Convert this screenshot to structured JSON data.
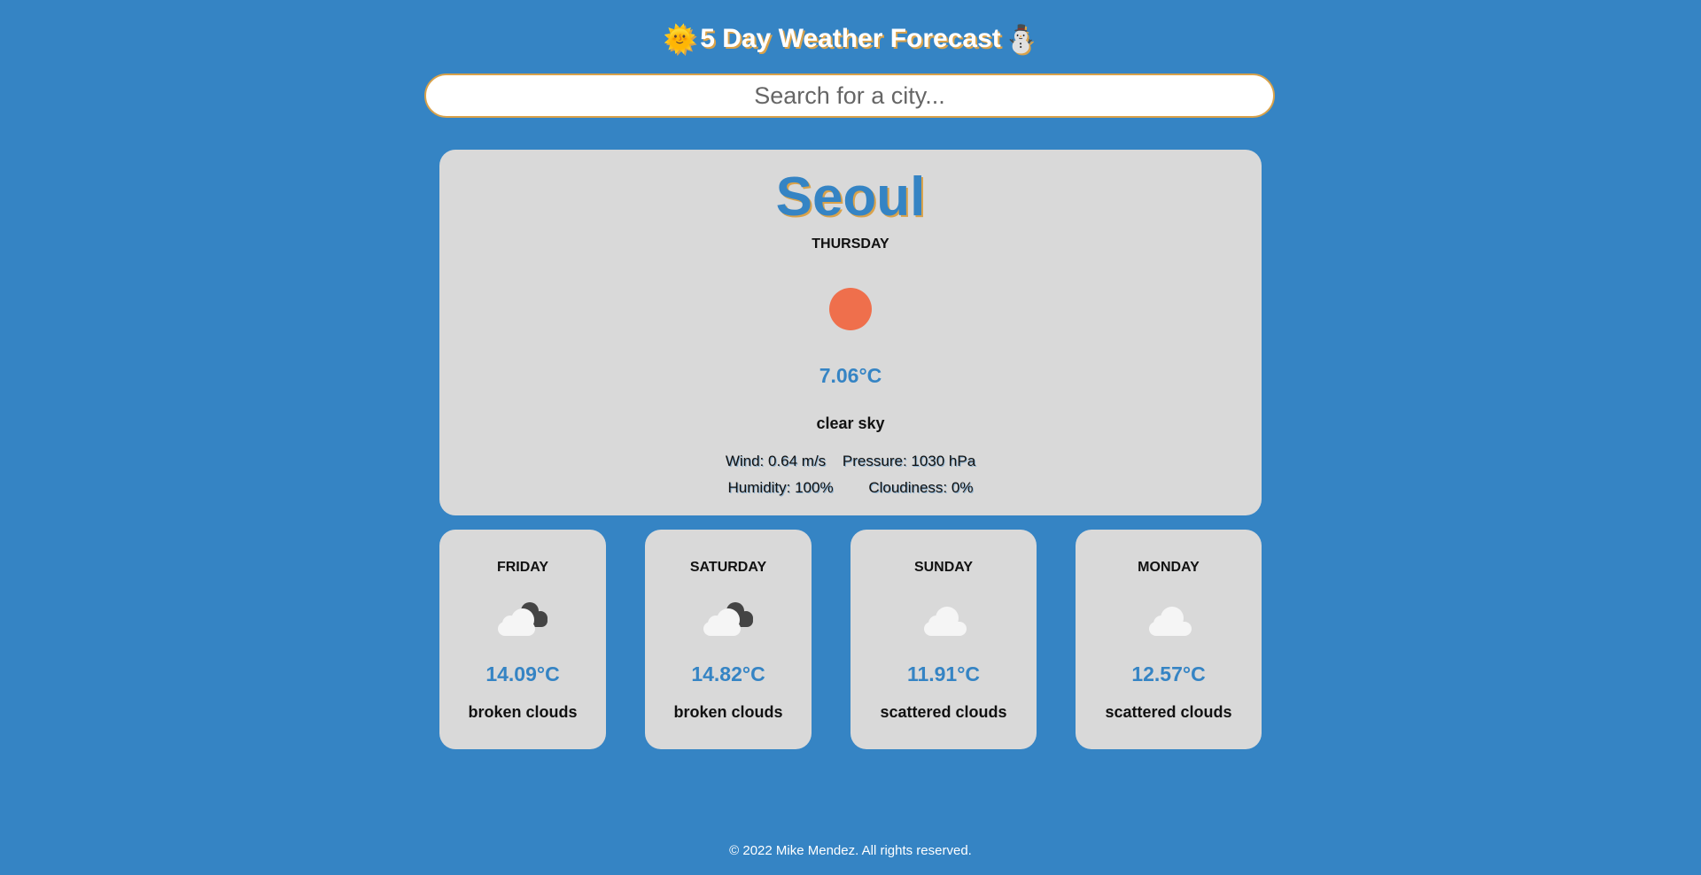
{
  "header": {
    "title": "5 Day Weather Forecast",
    "emoji_left": "🌞",
    "emoji_right": "⛄"
  },
  "search": {
    "placeholder": "Search for a city..."
  },
  "current": {
    "city": "Seoul",
    "day": "THURSDAY",
    "icon": "sun-icon",
    "temperature": "7.06°C",
    "description": "clear sky",
    "wind": "Wind: 0.64 m/s",
    "pressure": "Pressure: 1030 hPa",
    "humidity": "Humidity: 100%",
    "cloudiness": "Cloudiness: 0%"
  },
  "forecast": [
    {
      "day": "FRIDAY",
      "icon": "broken-clouds-icon",
      "temperature": "14.09°C",
      "description": "broken clouds"
    },
    {
      "day": "SATURDAY",
      "icon": "broken-clouds-icon",
      "temperature": "14.82°C",
      "description": "broken clouds"
    },
    {
      "day": "SUNDAY",
      "icon": "scattered-clouds-icon",
      "temperature": "11.91°C",
      "description": "scattered clouds"
    },
    {
      "day": "MONDAY",
      "icon": "scattered-clouds-icon",
      "temperature": "12.57°C",
      "description": "scattered clouds"
    }
  ],
  "footer": {
    "text": "© 2022 Mike Mendez. All rights reserved."
  },
  "colors": {
    "background": "#3584c4",
    "card": "#d9d9d9",
    "accent": "#3584c4",
    "shadow": "#d9a24a",
    "sun": "#ef6f4c"
  }
}
